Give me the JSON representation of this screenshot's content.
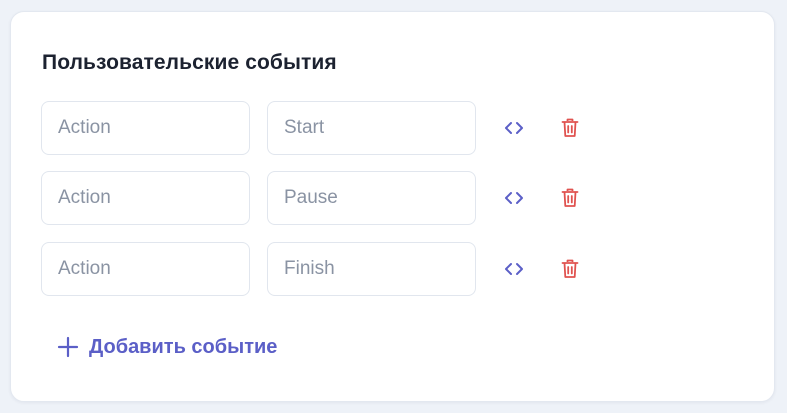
{
  "section": {
    "title": "Пользовательские события"
  },
  "events": [
    {
      "name_placeholder": "Action",
      "value": "Start"
    },
    {
      "name_placeholder": "Action",
      "value": "Pause"
    },
    {
      "name_placeholder": "Action",
      "value": "Finish"
    }
  ],
  "actions": {
    "add_label": "Добавить событие"
  },
  "icons": {
    "code": "code-icon",
    "delete": "trash-icon",
    "add": "plus-icon"
  },
  "colors": {
    "accent": "#5b5fc7",
    "danger": "#e0524f",
    "title": "#1c2230",
    "placeholder": "#8a93a3",
    "border": "#e1e6ee"
  }
}
